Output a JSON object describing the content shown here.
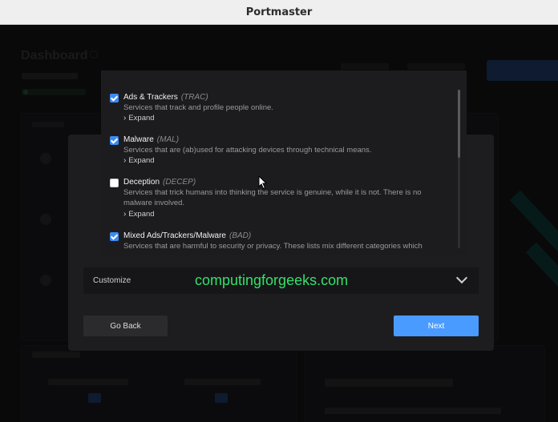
{
  "window": {
    "title": "Portmaster"
  },
  "filter_lists": [
    {
      "name": "Ads & Trackers",
      "code": "(TRAC)",
      "description": "Services that track and profile people online.",
      "checked": true,
      "expand_label": "Expand"
    },
    {
      "name": "Malware",
      "code": "(MAL)",
      "description": "Services that are (ab)used for attacking devices through technical means.",
      "checked": true,
      "expand_label": "Expand"
    },
    {
      "name": "Deception",
      "code": "(DECEP)",
      "description": "Services that trick humans into thinking the service is genuine, while it is not. There is no malware involved.",
      "checked": false,
      "expand_label": "Expand"
    },
    {
      "name": "Mixed Ads/Trackers/Malware",
      "code": "(BAD)",
      "description": "Services that are harmful to security or privacy. These lists mix different categories which",
      "checked": true
    }
  ],
  "customize": {
    "label": "Customize"
  },
  "buttons": {
    "back_label": "Go Back",
    "next_label": "Next"
  },
  "watermark": "computingforgeeks.com",
  "colors": {
    "accent": "#4a9bff",
    "checkbox": "#3c8bf5",
    "watermark": "#35e06a"
  },
  "icons": {
    "expand": "chevron-right-icon",
    "customize": "chevron-down-icon",
    "cursor": "mouse-pointer-icon"
  }
}
